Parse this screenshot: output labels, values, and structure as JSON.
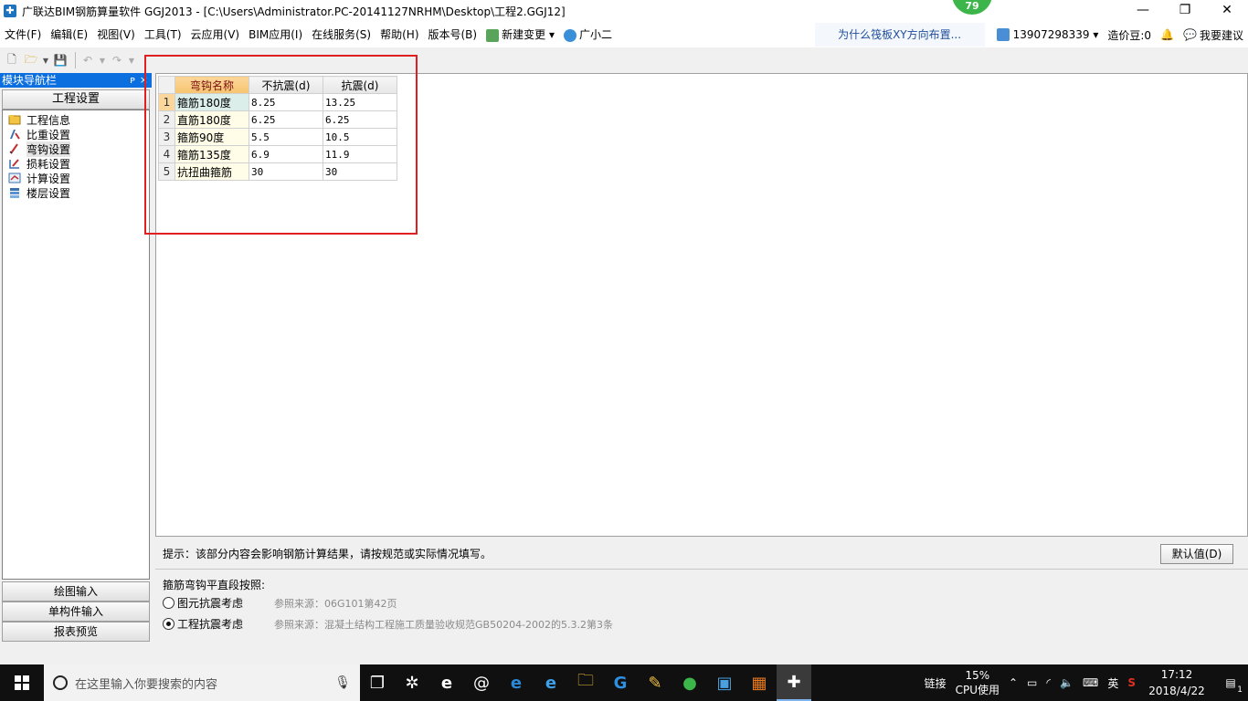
{
  "window": {
    "title": "广联达BIM钢筋算量软件 GGJ2013 - [C:\\Users\\Administrator.PC-20141127NRHM\\Desktop\\工程2.GGJ12]",
    "badge": "79",
    "minimize": "—",
    "restore": "❐",
    "close": "✕"
  },
  "menu": {
    "items": [
      "文件(F)",
      "编辑(E)",
      "视图(V)",
      "工具(T)",
      "云应用(V)",
      "BIM应用(I)",
      "在线服务(S)",
      "帮助(H)",
      "版本号(B)"
    ],
    "new_change": "新建变更",
    "guangxiaoer": "广小二",
    "notice": "为什么筏板XY方向布置...",
    "phone": "13907298339",
    "price_bean": "造价豆:0",
    "suggest": "我要建议"
  },
  "sidebar": {
    "title": "模块导航栏",
    "pin": "ᴘ",
    "close": "×",
    "section": "工程设置",
    "items": [
      {
        "label": "工程信息",
        "icon": "folder-icon"
      },
      {
        "label": "比重设置",
        "icon": "weight-icon"
      },
      {
        "label": "弯钩设置",
        "icon": "hook-icon"
      },
      {
        "label": "损耗设置",
        "icon": "loss-icon"
      },
      {
        "label": "计算设置",
        "icon": "calc-icon"
      },
      {
        "label": "楼层设置",
        "icon": "floor-icon"
      }
    ],
    "bottom_tabs": [
      "绘图输入",
      "单构件输入",
      "报表预览"
    ]
  },
  "table": {
    "headers": [
      "弯钩名称",
      "不抗震(d)",
      "抗震(d)"
    ],
    "rows": [
      {
        "num": "1",
        "name": "箍筋180度",
        "non_seismic": "8.25",
        "seismic": "13.25"
      },
      {
        "num": "2",
        "name": "直筋180度",
        "non_seismic": "6.25",
        "seismic": "6.25"
      },
      {
        "num": "3",
        "name": "箍筋90度",
        "non_seismic": "5.5",
        "seismic": "10.5"
      },
      {
        "num": "4",
        "name": "箍筋135度",
        "non_seismic": "6.9",
        "seismic": "11.9"
      },
      {
        "num": "5",
        "name": "抗扭曲箍筋",
        "non_seismic": "30",
        "seismic": "30"
      }
    ]
  },
  "hint": {
    "text": "提示：该部分内容会影响钢筋计算结果，请按规范或实际情况填写。",
    "default_button": "默认值(D)"
  },
  "options": {
    "title": "箍筋弯钩平直段按照:",
    "items": [
      {
        "label": "图元抗震考虑",
        "ref": "参照来源：06G101第42页",
        "checked": false
      },
      {
        "label": "工程抗震考虑",
        "ref": "参照来源：混凝土结构工程施工质量验收规范GB50204-2002的5.3.2第3条",
        "checked": true
      }
    ]
  },
  "taskbar": {
    "search_placeholder": "在这里输入你要搜索的内容",
    "link": "链接",
    "cpu_percent": "15%",
    "cpu_label": "CPU使用",
    "ime": "英",
    "time": "17:12",
    "date": "2018/4/22",
    "notification_count": "1"
  }
}
